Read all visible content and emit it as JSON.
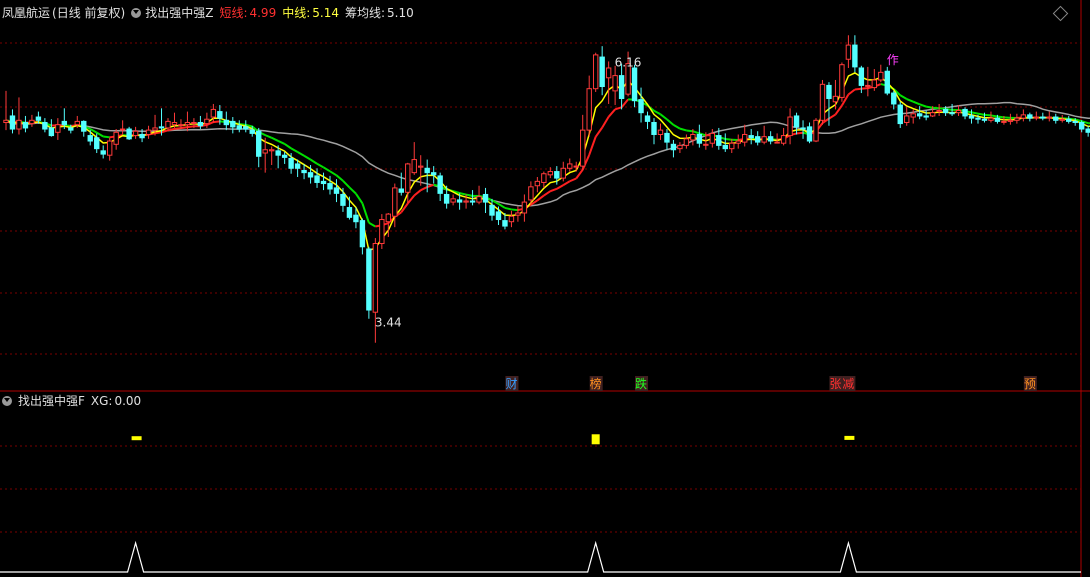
{
  "header": {
    "stock_name": "凤凰航运",
    "period": "(日线 前复权)",
    "indicator": "找出强中强Z",
    "short_label": "短线:",
    "short_value": "4.99",
    "mid_label": "中线:",
    "mid_value": "5.14",
    "chip_label": "筹均线:",
    "chip_value": "5.10"
  },
  "sub_header": {
    "indicator": "找出强中强F",
    "xg_label": "XG:",
    "xg_value": "0.00"
  },
  "colors": {
    "up": "#ff3a3a",
    "down": "#54ffff",
    "short": "#ff2020",
    "mid_up": "#ff2020",
    "mid_down": "#00e000",
    "chip": "#a0a0a0",
    "yellow": "#ffff00",
    "grid": "#7a0000"
  },
  "chart_data": {
    "type": "candlestick",
    "y_range": [
      3.3,
      6.4
    ],
    "annotations": [
      {
        "text": "6.16",
        "index": 93
      },
      {
        "text": "3.44",
        "index": 56
      },
      {
        "text": "筹均线",
        "index": 172
      },
      {
        "text": "作",
        "index": 135
      }
    ],
    "bottom_tags": [
      {
        "text": "财",
        "index": 78,
        "color": "#39a0ff"
      },
      {
        "text": "榜",
        "index": 91,
        "color": "#ff9020"
      },
      {
        "text": "跌",
        "index": 98,
        "color": "#20ff20"
      },
      {
        "text": "张",
        "index": 128,
        "color": "#ff3030"
      },
      {
        "text": "减",
        "index": 130,
        "color": "#ff3030"
      },
      {
        "text": "预",
        "index": 158,
        "color": "#ff9020"
      }
    ],
    "candles": [
      [
        5.46,
        5.48,
        5.75,
        5.39
      ],
      [
        5.52,
        5.4,
        5.58,
        5.36
      ],
      [
        5.4,
        5.48,
        5.69,
        5.35
      ],
      [
        5.46,
        5.41,
        5.52,
        5.37
      ],
      [
        5.45,
        5.48,
        5.53,
        5.42
      ],
      [
        5.51,
        5.48,
        5.56,
        5.45
      ],
      [
        5.46,
        5.4,
        5.5,
        5.37
      ],
      [
        5.41,
        5.34,
        5.49,
        5.33
      ],
      [
        5.37,
        5.44,
        5.5,
        5.3
      ],
      [
        5.47,
        5.44,
        5.59,
        5.4
      ],
      [
        5.41,
        5.39,
        5.44,
        5.36
      ],
      [
        5.44,
        5.47,
        5.52,
        5.41
      ],
      [
        5.47,
        5.38,
        5.48,
        5.33
      ],
      [
        5.34,
        5.29,
        5.39,
        5.25
      ],
      [
        5.32,
        5.22,
        5.36,
        5.18
      ],
      [
        5.2,
        5.17,
        5.25,
        5.13
      ],
      [
        5.16,
        5.29,
        5.32,
        5.11
      ],
      [
        5.26,
        5.37,
        5.4,
        5.21
      ],
      [
        5.4,
        5.4,
        5.48,
        5.35
      ],
      [
        5.4,
        5.31,
        5.42,
        5.3
      ],
      [
        5.34,
        5.38,
        5.42,
        5.31
      ],
      [
        5.35,
        5.32,
        5.4,
        5.28
      ],
      [
        5.35,
        5.39,
        5.43,
        5.31
      ],
      [
        5.39,
        5.41,
        5.53,
        5.34
      ],
      [
        5.42,
        5.41,
        5.59,
        5.34
      ],
      [
        5.41,
        5.47,
        5.5,
        5.38
      ],
      [
        5.44,
        5.46,
        5.55,
        5.41
      ],
      [
        5.44,
        5.44,
        5.49,
        5.4
      ],
      [
        5.44,
        5.46,
        5.56,
        5.38
      ],
      [
        5.46,
        5.46,
        5.5,
        5.41
      ],
      [
        5.46,
        5.43,
        5.52,
        5.4
      ],
      [
        5.45,
        5.49,
        5.55,
        5.41
      ],
      [
        5.51,
        5.58,
        5.63,
        5.46
      ],
      [
        5.56,
        5.5,
        5.62,
        5.44
      ],
      [
        5.48,
        5.44,
        5.56,
        5.39
      ],
      [
        5.47,
        5.42,
        5.51,
        5.36
      ],
      [
        5.43,
        5.4,
        5.48,
        5.37
      ],
      [
        5.42,
        5.4,
        5.48,
        5.37
      ],
      [
        5.39,
        5.36,
        5.43,
        5.33
      ],
      [
        5.38,
        5.15,
        5.41,
        5.05
      ],
      [
        5.18,
        5.21,
        5.32,
        5.0
      ],
      [
        5.2,
        5.21,
        5.24,
        5.07
      ],
      [
        5.2,
        5.16,
        5.25,
        5.04
      ],
      [
        5.16,
        5.14,
        5.19,
        5.08
      ],
      [
        5.13,
        5.04,
        5.18,
        4.99
      ],
      [
        5.08,
        5.04,
        5.12,
        4.96
      ],
      [
        5.02,
        5.0,
        5.08,
        4.94
      ],
      [
        5.0,
        4.96,
        5.07,
        4.9
      ],
      [
        4.97,
        4.91,
        5.04,
        4.86
      ],
      [
        4.92,
        4.9,
        5.0,
        4.84
      ],
      [
        4.9,
        4.85,
        4.97,
        4.8
      ],
      [
        4.86,
        4.81,
        4.94,
        4.73
      ],
      [
        4.8,
        4.7,
        4.86,
        4.64
      ],
      [
        4.68,
        4.59,
        4.78,
        4.57
      ],
      [
        4.61,
        4.55,
        4.68,
        4.49
      ],
      [
        4.56,
        4.32,
        4.58,
        4.25
      ],
      [
        4.3,
        3.74,
        4.32,
        3.66
      ],
      [
        3.72,
        4.35,
        4.4,
        3.44
      ],
      [
        4.35,
        4.57,
        4.62,
        4.3
      ],
      [
        4.55,
        4.62,
        4.63,
        4.41
      ],
      [
        4.6,
        4.86,
        4.9,
        4.5
      ],
      [
        4.85,
        4.82,
        5.0,
        4.79
      ],
      [
        4.82,
        5.08,
        5.09,
        4.72
      ],
      [
        5.0,
        5.12,
        5.28,
        4.98
      ],
      [
        5.05,
        5.06,
        5.16,
        4.88
      ],
      [
        5.04,
        5.0,
        5.12,
        4.82
      ],
      [
        5.0,
        4.98,
        5.06,
        4.9
      ],
      [
        4.97,
        4.81,
        5.0,
        4.74
      ],
      [
        4.8,
        4.72,
        4.88,
        4.67
      ],
      [
        4.73,
        4.76,
        4.8,
        4.7
      ],
      [
        4.75,
        4.73,
        4.81,
        4.66
      ],
      [
        4.73,
        4.74,
        4.8,
        4.67
      ],
      [
        4.74,
        4.73,
        4.84,
        4.7
      ],
      [
        4.73,
        4.78,
        4.88,
        4.71
      ],
      [
        4.8,
        4.73,
        4.86,
        4.63
      ],
      [
        4.7,
        4.61,
        4.76,
        4.56
      ],
      [
        4.64,
        4.57,
        4.69,
        4.52
      ],
      [
        4.56,
        4.51,
        4.63,
        4.48
      ],
      [
        4.55,
        4.6,
        4.65,
        4.5
      ],
      [
        4.61,
        4.63,
        4.69,
        4.55
      ],
      [
        4.63,
        4.73,
        4.8,
        4.55
      ],
      [
        4.75,
        4.87,
        4.92,
        4.71
      ],
      [
        4.88,
        4.92,
        4.96,
        4.82
      ],
      [
        4.91,
        4.99,
        5.01,
        4.86
      ],
      [
        4.98,
        5.01,
        5.05,
        4.95
      ],
      [
        5.01,
        4.95,
        5.06,
        4.89
      ],
      [
        4.95,
        5.04,
        5.1,
        4.92
      ],
      [
        5.04,
        5.08,
        5.13,
        5.01
      ],
      [
        5.06,
        5.06,
        5.1,
        5.01
      ],
      [
        5.06,
        5.39,
        5.53,
        5.02
      ],
      [
        5.39,
        5.77,
        5.89,
        5.33
      ],
      [
        5.77,
        6.08,
        6.1,
        5.74
      ],
      [
        6.06,
        5.79,
        6.16,
        5.71
      ],
      [
        5.87,
        5.96,
        6.02,
        5.63
      ],
      [
        5.75,
        5.89,
        5.98,
        5.62
      ],
      [
        5.89,
        5.68,
        6.0,
        5.58
      ],
      [
        5.72,
        6.0,
        6.11,
        5.7
      ],
      [
        5.96,
        5.66,
        5.99,
        5.6
      ],
      [
        5.67,
        5.55,
        5.78,
        5.46
      ],
      [
        5.52,
        5.47,
        5.56,
        5.4
      ],
      [
        5.46,
        5.35,
        5.5,
        5.26
      ],
      [
        5.35,
        5.39,
        5.45,
        5.3
      ],
      [
        5.36,
        5.28,
        5.4,
        5.21
      ],
      [
        5.26,
        5.21,
        5.3,
        5.14
      ],
      [
        5.22,
        5.25,
        5.28,
        5.18
      ],
      [
        5.25,
        5.31,
        5.35,
        5.22
      ],
      [
        5.3,
        5.35,
        5.4,
        5.25
      ],
      [
        5.35,
        5.27,
        5.44,
        5.23
      ],
      [
        5.26,
        5.26,
        5.37,
        5.21
      ],
      [
        5.27,
        5.36,
        5.4,
        5.23
      ],
      [
        5.34,
        5.25,
        5.41,
        5.21
      ],
      [
        5.25,
        5.22,
        5.36,
        5.19
      ],
      [
        5.22,
        5.27,
        5.31,
        5.18
      ],
      [
        5.27,
        5.29,
        5.35,
        5.22
      ],
      [
        5.28,
        5.35,
        5.44,
        5.24
      ],
      [
        5.34,
        5.32,
        5.4,
        5.26
      ],
      [
        5.33,
        5.28,
        5.38,
        5.25
      ],
      [
        5.28,
        5.33,
        5.43,
        5.26
      ],
      [
        5.33,
        5.29,
        5.38,
        5.26
      ],
      [
        5.28,
        5.28,
        5.36,
        5.27
      ],
      [
        5.27,
        5.34,
        5.41,
        5.25
      ],
      [
        5.34,
        5.51,
        5.59,
        5.26
      ],
      [
        5.52,
        5.42,
        5.55,
        5.35
      ],
      [
        5.41,
        5.4,
        5.48,
        5.31
      ],
      [
        5.42,
        5.29,
        5.46,
        5.27
      ],
      [
        5.29,
        5.48,
        5.5,
        5.28
      ],
      [
        5.48,
        5.81,
        5.85,
        5.44
      ],
      [
        5.8,
        5.68,
        5.83,
        5.43
      ],
      [
        5.65,
        5.7,
        5.85,
        5.58
      ],
      [
        5.69,
        5.99,
        6.01,
        5.65
      ],
      [
        6.04,
        6.17,
        6.26,
        5.96
      ],
      [
        6.17,
        5.97,
        6.26,
        5.92
      ],
      [
        5.96,
        5.8,
        5.98,
        5.73
      ],
      [
        5.8,
        5.8,
        5.97,
        5.7
      ],
      [
        5.78,
        5.85,
        5.95,
        5.75
      ],
      [
        5.85,
        5.92,
        5.99,
        5.83
      ],
      [
        5.93,
        5.73,
        5.97,
        5.71
      ],
      [
        5.73,
        5.63,
        5.75,
        5.58
      ],
      [
        5.62,
        5.45,
        5.65,
        5.41
      ],
      [
        5.46,
        5.52,
        5.6,
        5.43
      ],
      [
        5.51,
        5.54,
        5.58,
        5.45
      ],
      [
        5.54,
        5.52,
        5.61,
        5.49
      ],
      [
        5.52,
        5.51,
        5.57,
        5.48
      ],
      [
        5.52,
        5.55,
        5.61,
        5.51
      ],
      [
        5.56,
        5.57,
        5.63,
        5.52
      ],
      [
        5.58,
        5.55,
        5.61,
        5.52
      ],
      [
        5.55,
        5.54,
        5.63,
        5.52
      ],
      [
        5.55,
        5.57,
        5.62,
        5.52
      ],
      [
        5.58,
        5.52,
        5.6,
        5.49
      ],
      [
        5.52,
        5.5,
        5.58,
        5.45
      ],
      [
        5.5,
        5.49,
        5.53,
        5.45
      ],
      [
        5.49,
        5.48,
        5.55,
        5.46
      ],
      [
        5.48,
        5.5,
        5.56,
        5.46
      ],
      [
        5.5,
        5.47,
        5.53,
        5.45
      ],
      [
        5.47,
        5.47,
        5.52,
        5.44
      ],
      [
        5.47,
        5.48,
        5.54,
        5.44
      ],
      [
        5.48,
        5.5,
        5.54,
        5.45
      ],
      [
        5.5,
        5.53,
        5.58,
        5.47
      ],
      [
        5.53,
        5.5,
        5.55,
        5.47
      ],
      [
        5.5,
        5.51,
        5.56,
        5.48
      ],
      [
        5.51,
        5.5,
        5.55,
        5.48
      ],
      [
        5.5,
        5.51,
        5.56,
        5.47
      ],
      [
        5.51,
        5.48,
        5.54,
        5.45
      ],
      [
        5.48,
        5.49,
        5.53,
        5.46
      ],
      [
        5.49,
        5.47,
        5.52,
        5.45
      ],
      [
        5.47,
        5.46,
        5.5,
        5.43
      ],
      [
        5.46,
        5.4,
        5.48,
        5.37
      ],
      [
        5.4,
        5.37,
        5.43,
        5.33
      ],
      [
        5.37,
        5.44,
        5.46,
        5.35
      ],
      [
        5.44,
        5.38,
        5.47,
        5.35
      ],
      [
        5.38,
        5.43,
        5.45,
        5.36
      ]
    ],
    "xg_signals": [
      {
        "index": 20,
        "level": 0.3
      },
      {
        "index": 91,
        "level": 0.62
      },
      {
        "index": 130,
        "level": 0.35
      }
    ],
    "spikes": [
      20,
      91,
      130
    ]
  }
}
